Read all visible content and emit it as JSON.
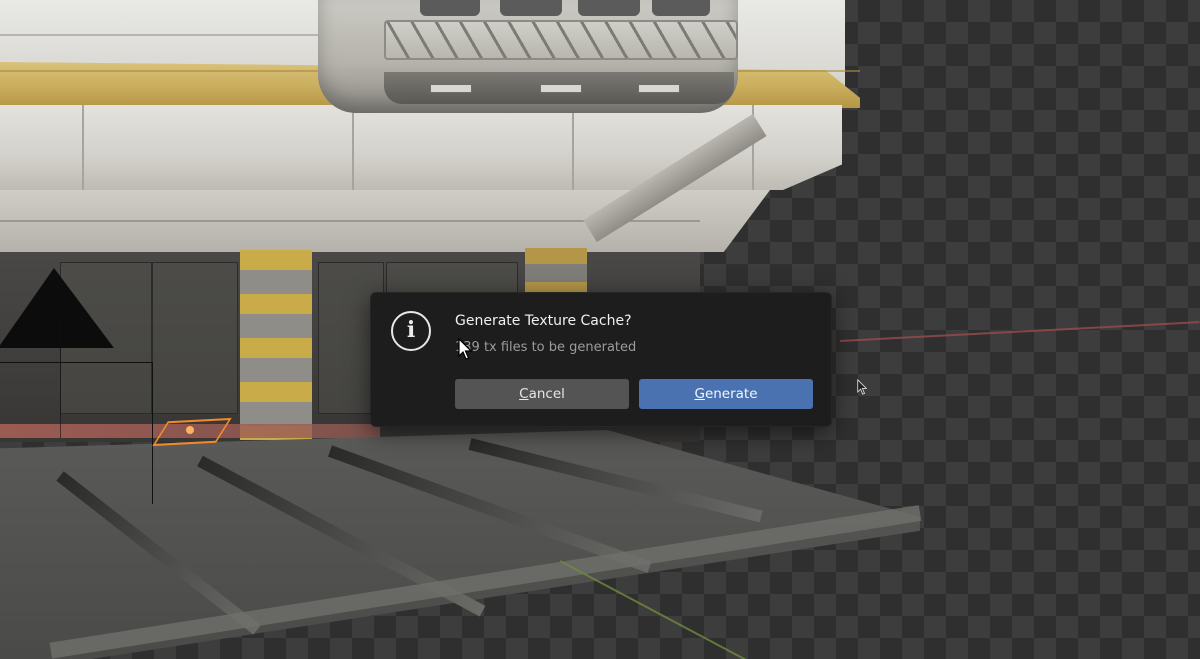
{
  "dialog": {
    "title": "Generate Texture Cache?",
    "message": "139 tx files to be generated",
    "icon": "info-icon",
    "buttons": {
      "cancel": {
        "mnemonic": "C",
        "rest": "ancel"
      },
      "generate": {
        "mnemonic": "G",
        "rest": "enerate"
      }
    }
  },
  "colors": {
    "dialog_bg": "#1d1d1d",
    "primary_button": "#4a72b0",
    "secondary_button": "#545454",
    "gizmo": "#f08a2a"
  }
}
